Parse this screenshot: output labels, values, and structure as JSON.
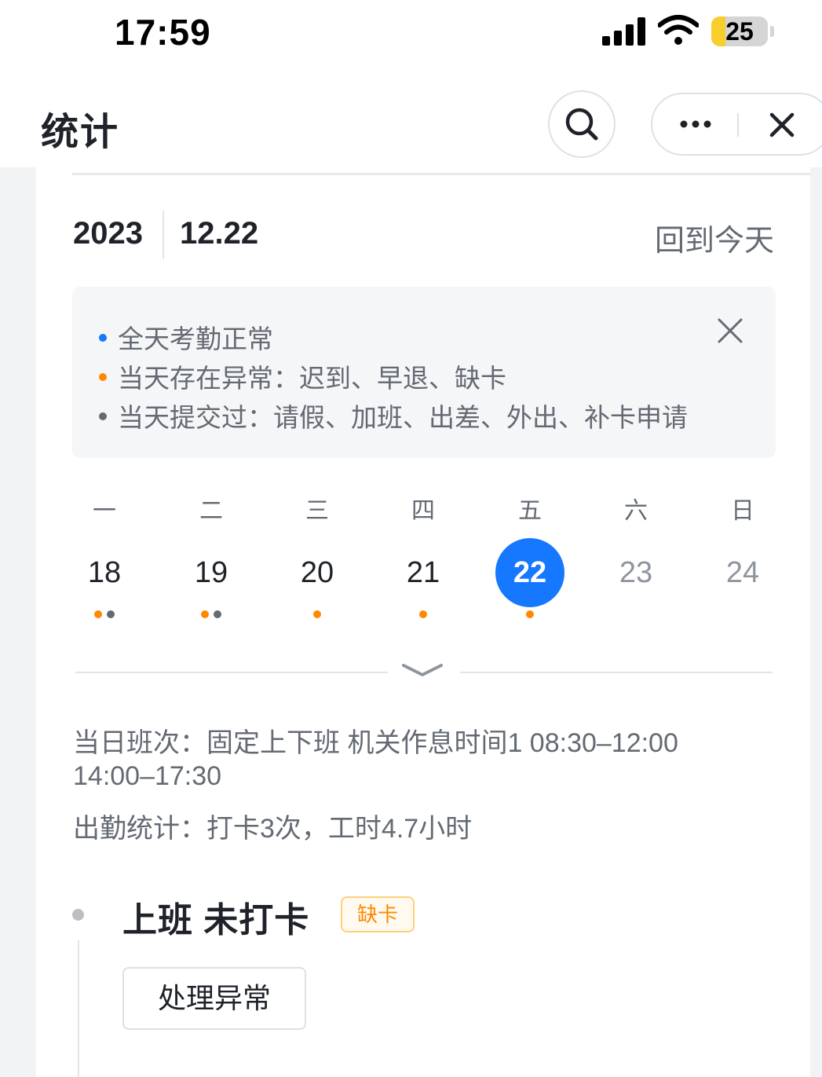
{
  "status_bar": {
    "time": "17:59",
    "battery": "25"
  },
  "header": {
    "title": "统计"
  },
  "date_bar": {
    "year": "2023",
    "day": "12.22",
    "back_today": "回到今天"
  },
  "legend": {
    "items": [
      {
        "text": "全天考勤正常",
        "color": "#1677ff"
      },
      {
        "text": "当天存在异常：迟到、早退、缺卡",
        "color": "#ff8800"
      },
      {
        "text": "当天提交过：请假、加班、出差、外出、补卡申请",
        "color": "#646a73"
      }
    ]
  },
  "calendar": {
    "weekdays": [
      "一",
      "二",
      "三",
      "四",
      "五",
      "六",
      "日"
    ],
    "days": [
      {
        "num": "18",
        "dots": [
          "#ff8800",
          "#646a73"
        ]
      },
      {
        "num": "19",
        "dots": [
          "#ff8800",
          "#646a73"
        ]
      },
      {
        "num": "20",
        "dots": [
          "#ff8800"
        ]
      },
      {
        "num": "21",
        "dots": [
          "#ff8800"
        ]
      },
      {
        "num": "22",
        "dots": [
          "#ff8800"
        ],
        "selected": true
      },
      {
        "num": "23",
        "dots": [],
        "weekend": true
      },
      {
        "num": "24",
        "dots": [],
        "weekend": true
      }
    ]
  },
  "shift": {
    "line1": "当日班次：固定上下班 机关作息时间1 08:30–12:00",
    "line2": "14:00–17:30",
    "stats": "出勤统计：打卡3次，工时4.7小时"
  },
  "punch": {
    "title": "上班 未打卡",
    "badge": "缺卡",
    "action": "处理异常"
  },
  "colors": {
    "accent": "#1677ff",
    "warning": "#ff8800",
    "muted": "#646a73"
  }
}
